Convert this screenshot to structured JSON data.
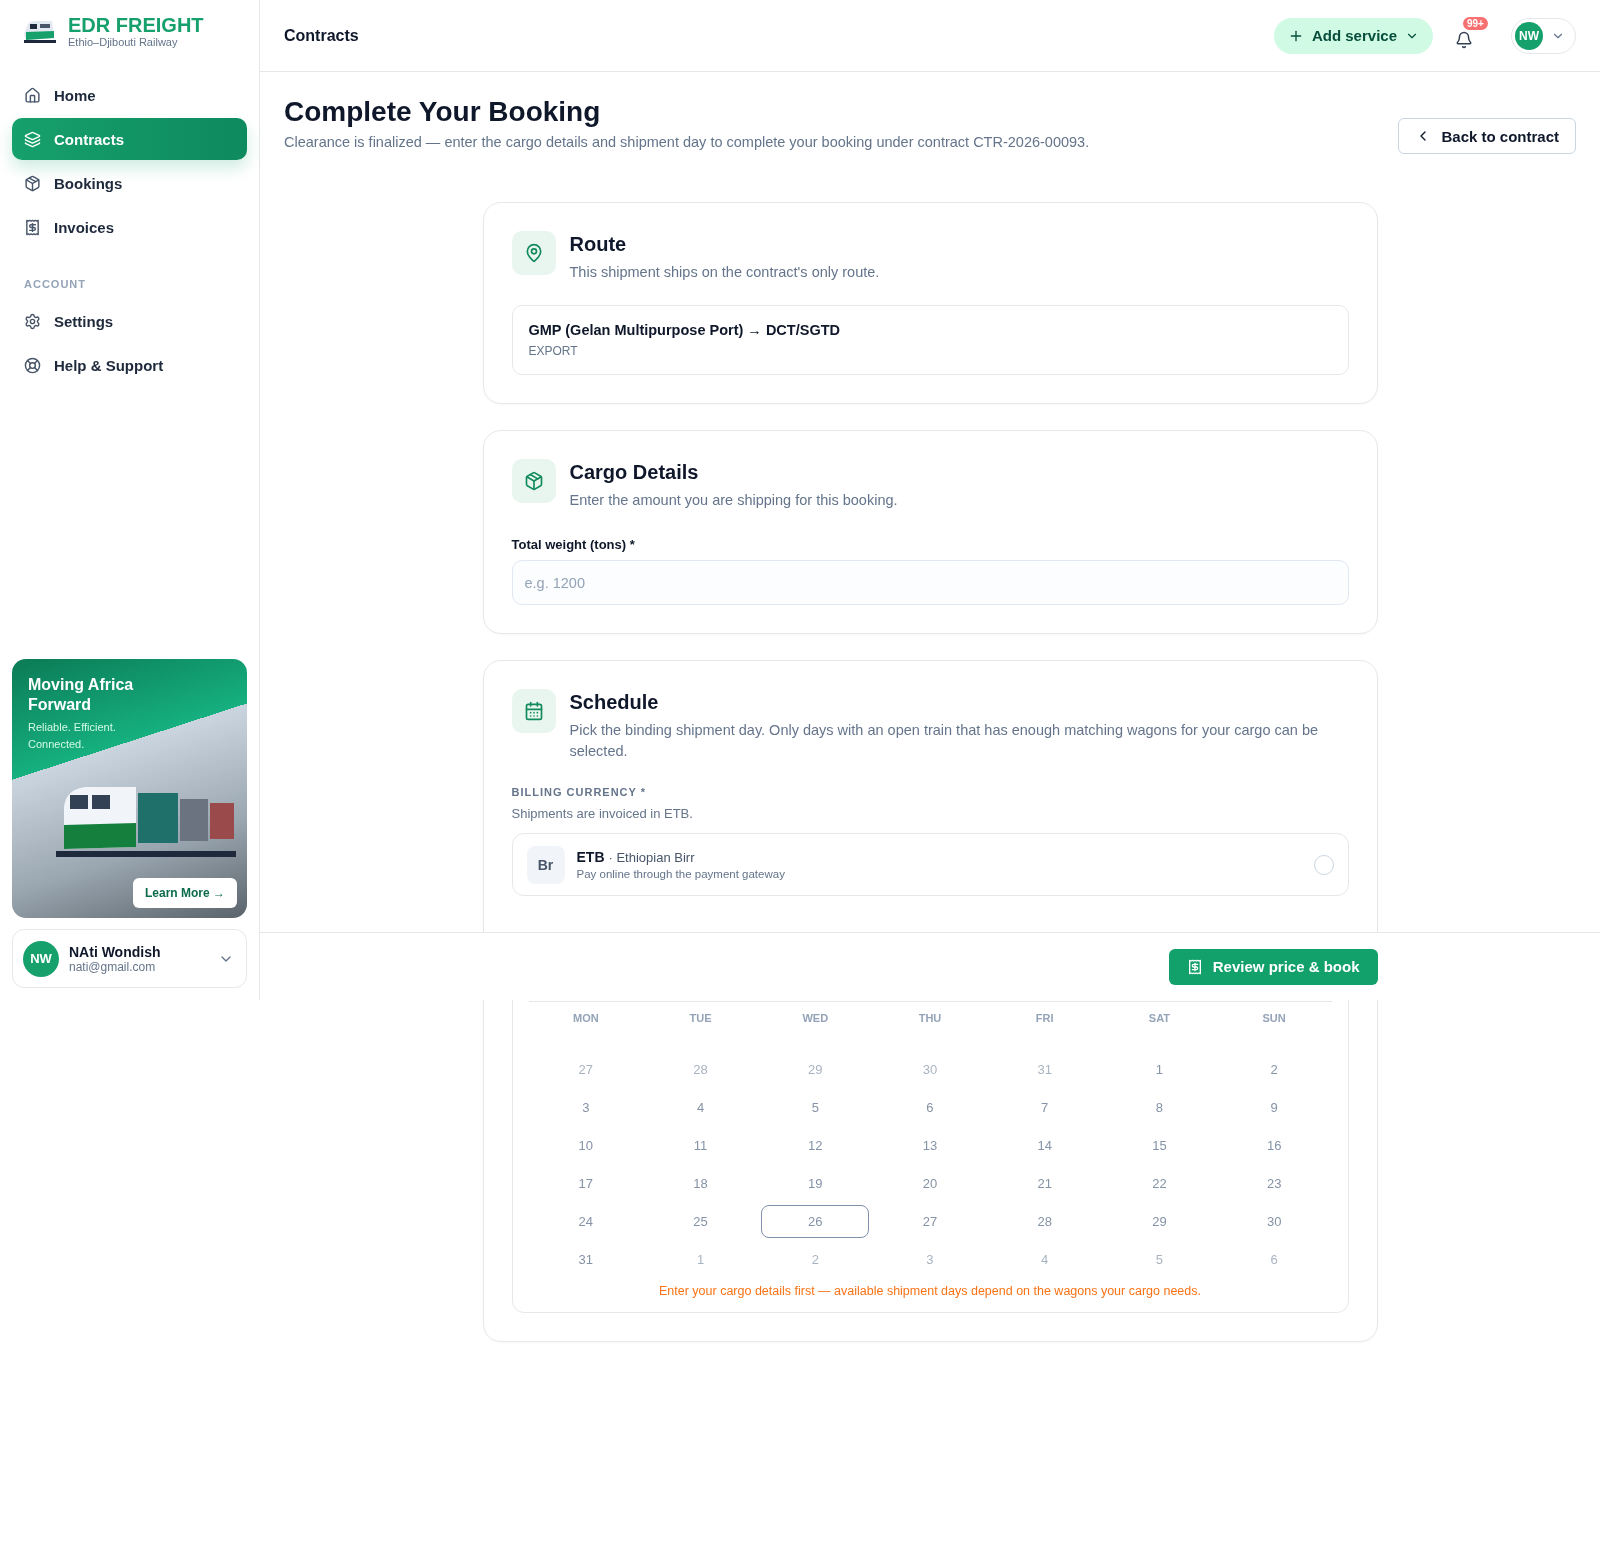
{
  "brand": {
    "name": "EDR FREIGHT",
    "tagline": "Ethio–Djibouti Railway"
  },
  "nav": [
    {
      "kind": "home",
      "label": "Home",
      "selected": false
    },
    {
      "kind": "contracts",
      "label": "Contracts",
      "selected": true
    },
    {
      "kind": "bookings",
      "label": "Bookings",
      "selected": false
    },
    {
      "kind": "invoices",
      "label": "Invoices",
      "selected": false
    }
  ],
  "account_section": {
    "heading": "ACCOUNT",
    "items": [
      {
        "kind": "settings",
        "label": "Settings",
        "selected": false
      },
      {
        "kind": "help",
        "label": "Help & Support",
        "selected": false
      }
    ]
  },
  "promo": {
    "title": "Moving Africa Forward",
    "subtitle": "Reliable. Efficient. Connected.",
    "button": "Learn More →"
  },
  "user": {
    "initials": "NW",
    "name": "NAti Wondish",
    "email": "nati@gmail.com"
  },
  "topbar": {
    "title": "Contracts",
    "add_button": "Add service",
    "notifications_badge": "99+",
    "avatar_initials": "NW"
  },
  "header": {
    "title": "Complete Your Booking",
    "subtitle": "Clearance is finalized — enter the cargo details and shipment day to complete your booking under contract CTR-2026-00093.",
    "back_button": "Back to contract"
  },
  "route_card": {
    "title": "Route",
    "description": "This shipment ships on the contract's only route.",
    "route": "GMP (Gelan Multipurpose Port) → DCT/SGTD",
    "direction": "EXPORT"
  },
  "cargo_card": {
    "title": "Cargo Details",
    "description": "Enter the amount you are shipping for this booking.",
    "weight_label": "Total weight (tons) *",
    "weight_placeholder": "e.g. 1200"
  },
  "schedule_card": {
    "title": "Schedule",
    "description": "Pick the binding shipment day. Only days with an open train that has enough matching wagons for your cargo can be selected.",
    "currency_label": "BILLING CURRENCY *",
    "currency_note": "Shipments are invoiced in ETB.",
    "currency_option": {
      "symbol": "Br",
      "code": "ETB",
      "name": "· Ethiopian Birr",
      "note": "Pay online through the payment gateway",
      "selected": false
    },
    "weekdays": [
      "MON",
      "TUE",
      "WED",
      "THU",
      "FRI",
      "SAT",
      "SUN"
    ],
    "days": [
      {
        "label": "27",
        "outside": true,
        "today": false
      },
      {
        "label": "28",
        "outside": true,
        "today": false
      },
      {
        "label": "29",
        "outside": true,
        "today": false
      },
      {
        "label": "30",
        "outside": true,
        "today": false
      },
      {
        "label": "31",
        "outside": true,
        "today": false
      },
      {
        "label": "1",
        "outside": false,
        "today": false
      },
      {
        "label": "2",
        "outside": false,
        "today": false
      },
      {
        "label": "3",
        "outside": false,
        "today": false
      },
      {
        "label": "4",
        "outside": false,
        "today": false
      },
      {
        "label": "5",
        "outside": false,
        "today": false
      },
      {
        "label": "6",
        "outside": false,
        "today": false
      },
      {
        "label": "7",
        "outside": false,
        "today": false
      },
      {
        "label": "8",
        "outside": false,
        "today": false
      },
      {
        "label": "9",
        "outside": false,
        "today": false
      },
      {
        "label": "10",
        "outside": false,
        "today": false
      },
      {
        "label": "11",
        "outside": false,
        "today": false
      },
      {
        "label": "12",
        "outside": false,
        "today": false
      },
      {
        "label": "13",
        "outside": false,
        "today": false
      },
      {
        "label": "14",
        "outside": false,
        "today": false
      },
      {
        "label": "15",
        "outside": false,
        "today": false
      },
      {
        "label": "16",
        "outside": false,
        "today": false
      },
      {
        "label": "17",
        "outside": false,
        "today": false
      },
      {
        "label": "18",
        "outside": false,
        "today": false
      },
      {
        "label": "19",
        "outside": false,
        "today": false
      },
      {
        "label": "20",
        "outside": false,
        "today": false
      },
      {
        "label": "21",
        "outside": false,
        "today": false
      },
      {
        "label": "22",
        "outside": false,
        "today": false
      },
      {
        "label": "23",
        "outside": false,
        "today": false
      },
      {
        "label": "24",
        "outside": false,
        "today": false
      },
      {
        "label": "25",
        "outside": false,
        "today": false
      },
      {
        "label": "26",
        "outside": false,
        "today": true
      },
      {
        "label": "27",
        "outside": false,
        "today": false
      },
      {
        "label": "28",
        "outside": false,
        "today": false
      },
      {
        "label": "29",
        "outside": false,
        "today": false
      },
      {
        "label": "30",
        "outside": false,
        "today": false
      },
      {
        "label": "31",
        "outside": false,
        "today": false
      },
      {
        "label": "1",
        "outside": true,
        "today": false
      },
      {
        "label": "2",
        "outside": true,
        "today": false
      },
      {
        "label": "3",
        "outside": true,
        "today": false
      },
      {
        "label": "4",
        "outside": true,
        "today": false
      },
      {
        "label": "5",
        "outside": true,
        "today": false
      },
      {
        "label": "6",
        "outside": true,
        "today": false
      }
    ],
    "calendar_note": "Enter your cargo details first — available shipment days depend on the wagons your cargo needs."
  },
  "footer": {
    "button": "Review price & book"
  }
}
